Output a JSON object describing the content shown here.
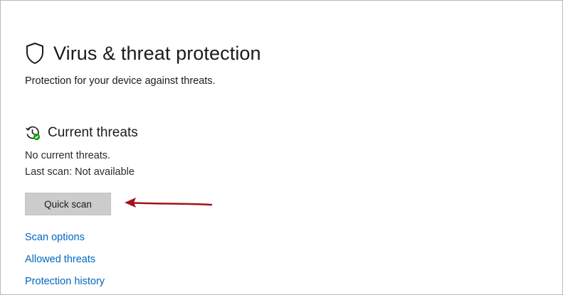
{
  "page": {
    "title": "Virus & threat protection",
    "subtitle": "Protection for your device against threats.",
    "title_icon": "shield-icon"
  },
  "current_threats": {
    "heading": "Current threats",
    "icon": "history-check-icon",
    "status": "No current threats.",
    "last_scan": "Last scan: Not available",
    "quick_scan_label": "Quick scan"
  },
  "links": [
    {
      "label": "Scan options"
    },
    {
      "label": "Allowed threats"
    },
    {
      "label": "Protection history"
    }
  ],
  "colors": {
    "link": "#0067c0",
    "button_bg": "#cccccc",
    "annotation_arrow": "#a3111b",
    "check_badge": "#13a10e"
  }
}
